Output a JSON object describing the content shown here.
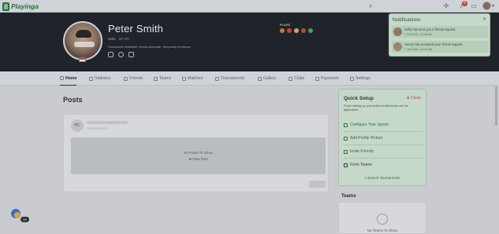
{
  "app": {
    "logo_text": "Playinga"
  },
  "topbar": {
    "search_icon": "search-icon",
    "icons": [
      "plus-icon",
      "bell-icon",
      "chat-icon"
    ],
    "notification_count": "6"
  },
  "profile": {
    "name": "Peter Smith",
    "meta": "Male · 22 Yrs",
    "bio": "Passionate footballer, tennis advocate, frequently immense.",
    "plays_label": "PLAYS"
  },
  "notifications": {
    "title": "Notifications",
    "items": [
      {
        "text": "Kelly has sent you a friend request",
        "time": "7 Oct 2025 • 11:45 AM"
      },
      {
        "text": "Henry has accepted your friend request",
        "time": "7 Oct 2025 • 10:30 AM"
      }
    ]
  },
  "tabs": [
    {
      "label": "Home",
      "active": true
    },
    {
      "label": "Statistics"
    },
    {
      "label": "Friends"
    },
    {
      "label": "Teams"
    },
    {
      "label": "Matches"
    },
    {
      "label": "Tournaments"
    },
    {
      "label": "Gallery"
    },
    {
      "label": "Clubs"
    },
    {
      "label": "Payments"
    },
    {
      "label": "Settings"
    }
  ],
  "posts": {
    "title": "Posts",
    "avatar_initials": "PC",
    "empty_text": "No Posts To Show",
    "new_post": "New Post"
  },
  "quick_setup": {
    "title": "Quick Setup",
    "close_label": "Close",
    "description": "Finish setting up your platform effectively use the application",
    "items": [
      {
        "label": "Configure Your Sports",
        "done": false
      },
      {
        "label": "Add Profile Picture",
        "done": false
      },
      {
        "label": "Invite Friends",
        "done": false
      },
      {
        "label": "Form Teams",
        "done": true
      }
    ],
    "search_label": "Search Tournaments"
  },
  "teams": {
    "title": "Teams",
    "empty_text": "No Teams To Show"
  },
  "fab": {
    "badge": "99"
  },
  "colors": {
    "accent_green": "#2d6e3c",
    "hero_bg": "#1f242b",
    "notif_bg": "#c5d9c8",
    "badge_red": "#c0403a"
  }
}
